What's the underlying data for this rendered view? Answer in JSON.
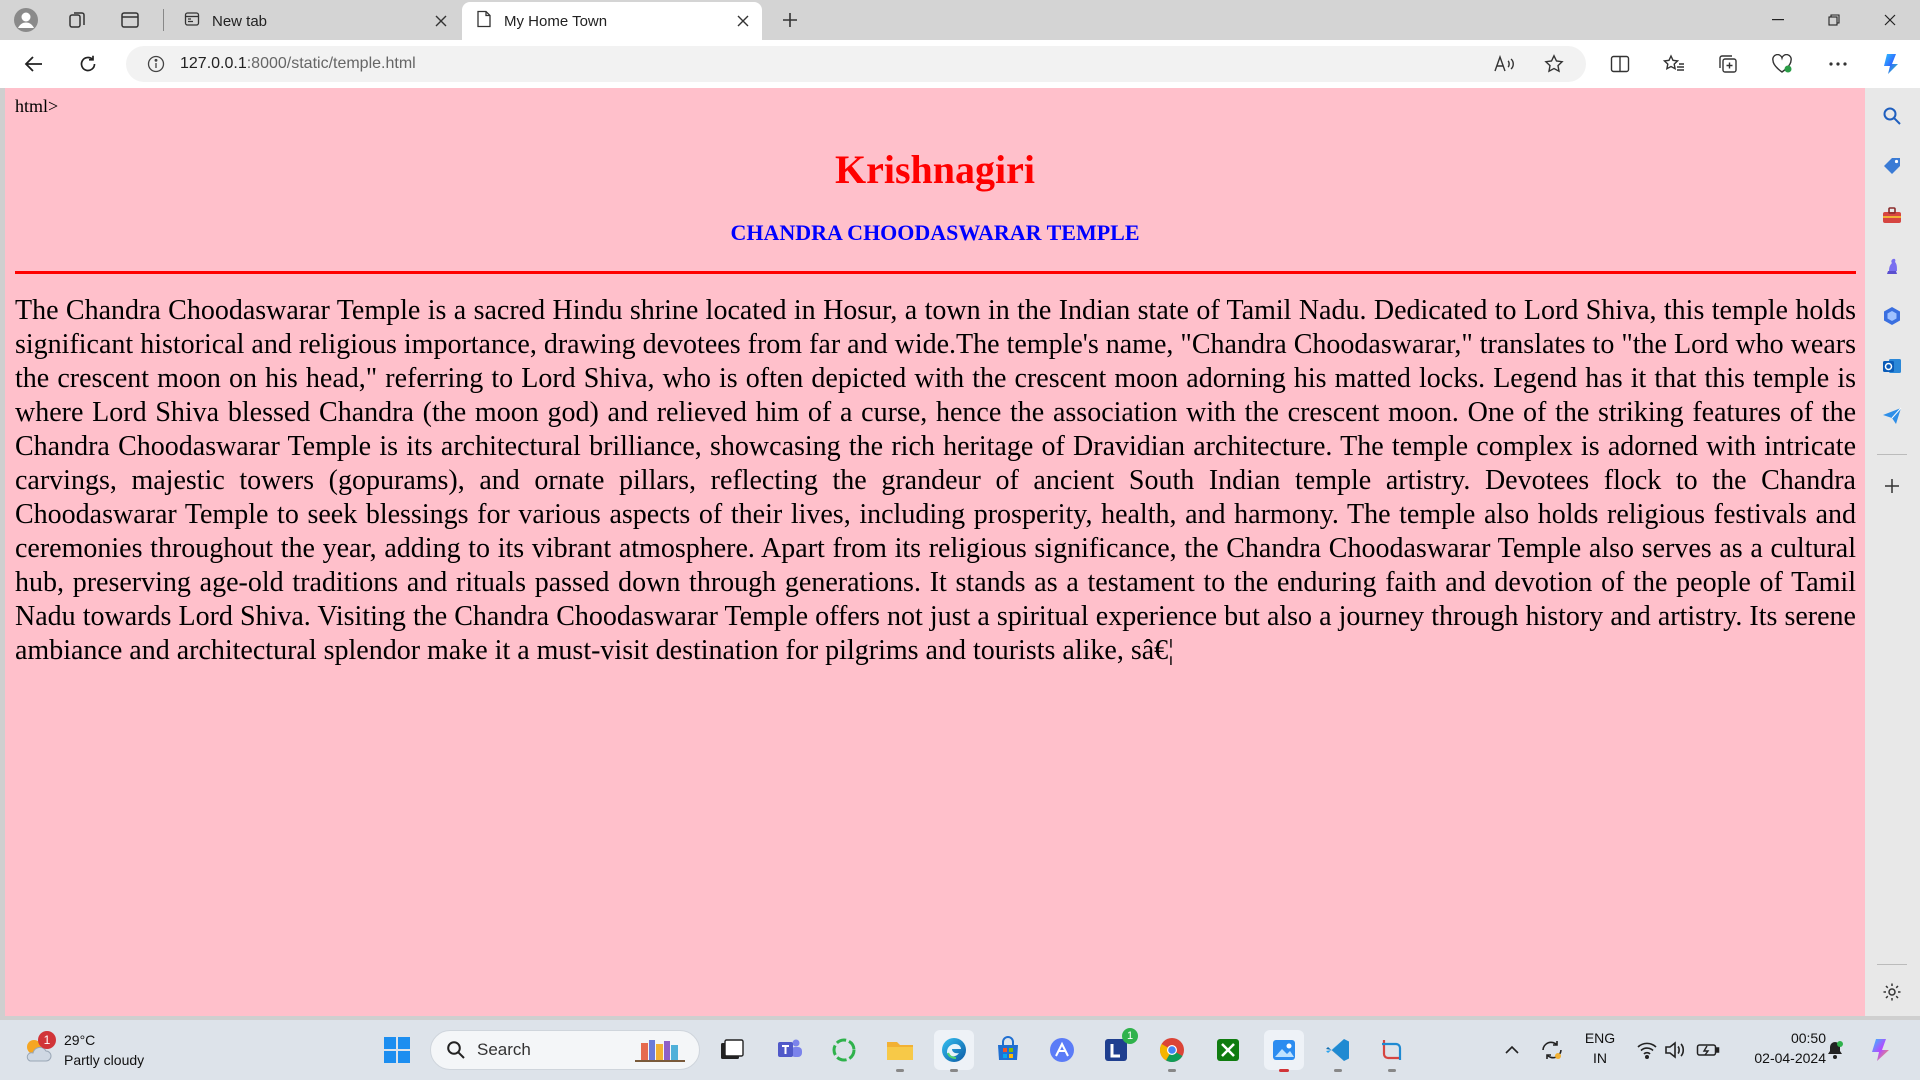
{
  "browser": {
    "tabs": [
      {
        "label": "New tab",
        "active": false
      },
      {
        "label": "My Home Town",
        "active": true
      }
    ],
    "url_host": "127.0.0.1",
    "url_rest": ":8000/static/temple.html"
  },
  "page": {
    "fragment": "html>",
    "title": "Krishnagiri",
    "subtitle": "CHANDRA CHOODASWARAR TEMPLE",
    "body": "The Chandra Choodaswarar Temple is a sacred Hindu shrine located in Hosur, a town in the Indian state of Tamil Nadu. Dedicated to Lord Shiva, this temple holds significant historical and religious importance, drawing devotees from far and wide.The temple's name, \"Chandra Choodaswarar,\" translates to \"the Lord who wears the crescent moon on his head,\" referring to Lord Shiva, who is often depicted with the crescent moon adorning his matted locks. Legend has it that this temple is where Lord Shiva blessed Chandra (the moon god) and relieved him of a curse, hence the association with the crescent moon. One of the striking features of the Chandra Choodaswarar Temple is its architectural brilliance, showcasing the rich heritage of Dravidian architecture. The temple complex is adorned with intricate carvings, majestic towers (gopurams), and ornate pillars, reflecting the grandeur of ancient South Indian temple artistry. Devotees flock to the Chandra Choodaswarar Temple to seek blessings for various aspects of their lives, including prosperity, health, and harmony. The temple also holds religious festivals and ceremonies throughout the year, adding to its vibrant atmosphere. Apart from its religious significance, the Chandra Choodaswarar Temple also serves as a cultural hub, preserving age-old traditions and rituals passed down through generations. It stands as a testament to the enduring faith and devotion of the people of Tamil Nadu towards Lord Shiva. Visiting the Chandra Choodaswarar Temple offers not just a spiritual experience but also a journey through history and artistry. Its serene ambiance and architectural splendor make it a must-visit destination for pilgrims and tourists alike, sâ€¦"
  },
  "taskbar": {
    "weather_temp": "29°C",
    "weather_desc": "Partly cloudy",
    "weather_badge": "1",
    "search_label": "Search",
    "lang_1": "ENG",
    "lang_2": "IN",
    "time": "00:50",
    "date": "02-04-2024",
    "app_badge": "1"
  },
  "colors": {
    "page_bg": "#ffc0cb",
    "title": "#ff0000",
    "subtitle": "#0000ff",
    "rule": "#ff0000"
  }
}
